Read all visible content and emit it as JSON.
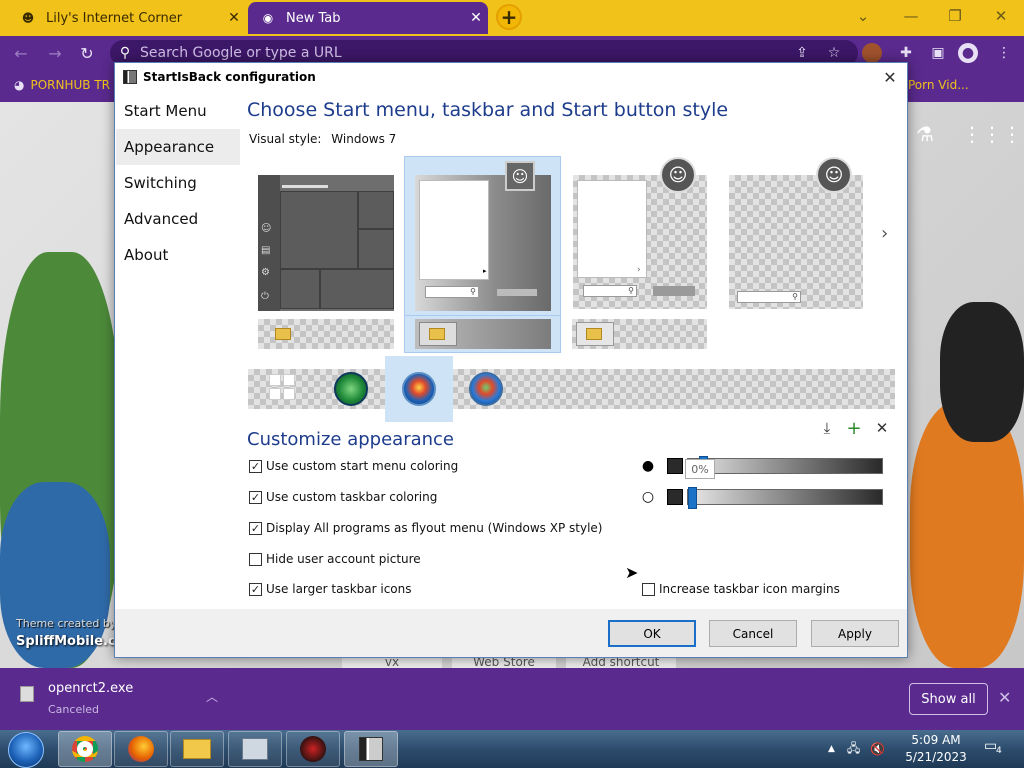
{
  "browser": {
    "tabs": [
      {
        "title": "Lily's Internet Corner",
        "close": "✕"
      },
      {
        "title": "New Tab",
        "close": "✕"
      }
    ],
    "new_tab": "+",
    "window_controls": {
      "minimize_tabs": "⌄",
      "minimize": "—",
      "restore": "❐",
      "close": "✕"
    },
    "omnibox_placeholder": "Search Google or type a URL",
    "bookmarks": [
      {
        "label": "PORNHUB TR"
      },
      {
        "label": "Porn Vid..."
      }
    ]
  },
  "page": {
    "watermark": "SpliffMobile.com",
    "watermark_faded": "Theme created by",
    "bottom_links": [
      "vx",
      "Web Store",
      "Add shortcut"
    ]
  },
  "dialog": {
    "title": "StartIsBack configuration",
    "sidebar": [
      {
        "label": "Start Menu",
        "selected": false
      },
      {
        "label": "Appearance",
        "selected": true
      },
      {
        "label": "Switching",
        "selected": false
      },
      {
        "label": "Advanced",
        "selected": false
      },
      {
        "label": "About",
        "selected": false
      }
    ],
    "heading": "Choose Start menu, taskbar and Start button style",
    "visual_style_label": "Visual style:",
    "visual_style_value": "Windows 7",
    "selected_style_index": 1,
    "selected_orb_index": 2,
    "customize_heading": "Customize appearance",
    "options": [
      {
        "label": "Use custom start menu coloring",
        "checked": true
      },
      {
        "label": "Use custom taskbar coloring",
        "checked": true
      },
      {
        "label": "Display All programs as flyout menu (Windows XP style)",
        "checked": true
      },
      {
        "label": "Hide user account picture",
        "checked": false
      },
      {
        "label": "Use larger taskbar icons",
        "checked": true
      }
    ],
    "margin_option": {
      "label": "Increase taskbar icon margins",
      "checked": false
    },
    "sliders": [
      {
        "icon": "drop-filled",
        "value": 0.06,
        "tooltip": "0%"
      },
      {
        "icon": "drop-outline",
        "value": 0.0
      }
    ],
    "buttons": {
      "ok": "OK",
      "cancel": "Cancel",
      "apply": "Apply"
    }
  },
  "downloads": {
    "file_name": "openrct2.exe",
    "status": "Canceled",
    "show_all": "Show all"
  },
  "taskbar": {
    "time": "5:09 AM",
    "date": "5/21/2023",
    "notification_count": "4"
  },
  "colors": {
    "browser_accent": "#5a2a8e",
    "tab_yellow": "#f0c21a",
    "dialog_heading": "#1d3c8c",
    "selection": "#cfe3f7"
  }
}
